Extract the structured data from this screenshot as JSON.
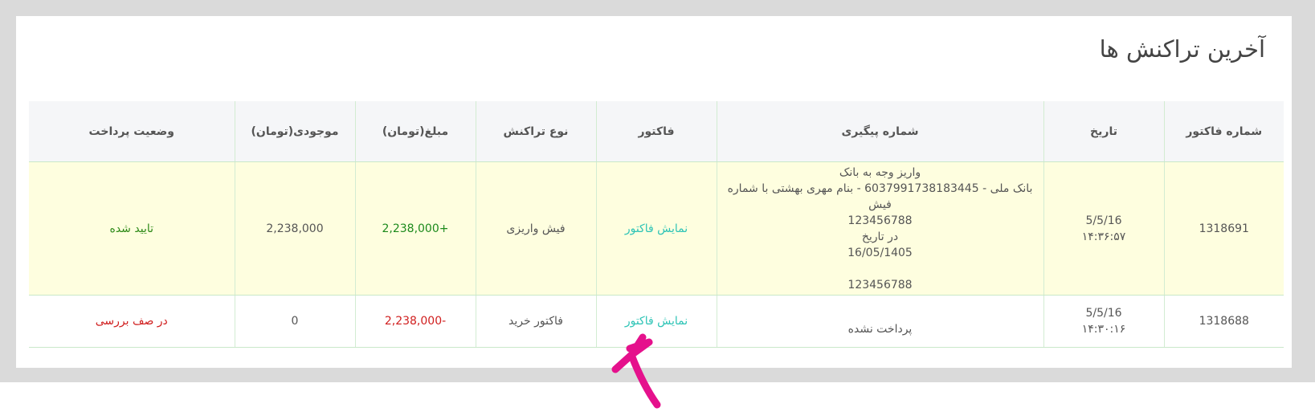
{
  "card": {
    "title": "آخرین تراکنش ها"
  },
  "table": {
    "headers": {
      "invoice_no": "شماره فاکتور",
      "date": "تاریخ",
      "tracking": "شماره پیگیری",
      "invoice": "فاکتور",
      "type": "نوع تراکنش",
      "amount": "مبلغ(تومان)",
      "balance": "موجودی(تومان)",
      "status": "وضعیت پرداخت"
    },
    "rows": [
      {
        "invoice_no": "1318691",
        "date": "5/5/16",
        "time": "۱۴:۳۶:۵۷",
        "tracking": {
          "line1": "واریز وجه به بانک",
          "line2": "بانک ملی - 6037991738183445 - بنام مهری بهشتی با شماره فیش",
          "line3": "123456788",
          "line4": "در تاریخ",
          "line5": "16/05/1405",
          "line6": "123456788"
        },
        "invoice_link": "نمایش فاکتور",
        "type": "فیش واریزی",
        "amount": "2,238,000+",
        "balance": "2,238,000",
        "status": "تایید شده"
      },
      {
        "invoice_no": "1318688",
        "date": "5/5/16",
        "time": "۱۴:۳۰:۱۶",
        "tracking": {
          "line1": "پرداخت نشده"
        },
        "invoice_link": "نمایش فاکتور",
        "type": "فاکتور خرید",
        "amount": "2,238,000-",
        "balance": "0",
        "status": "در صف بررسی"
      }
    ]
  },
  "colors": {
    "frame": "#dadada",
    "header_bg": "#f5f6f8",
    "highlight_row": "#fefedf",
    "link": "#2ec4b6",
    "positive": "#1c8a1c",
    "negative": "#d01e1e",
    "annotation_arrow": "#e5118c"
  }
}
